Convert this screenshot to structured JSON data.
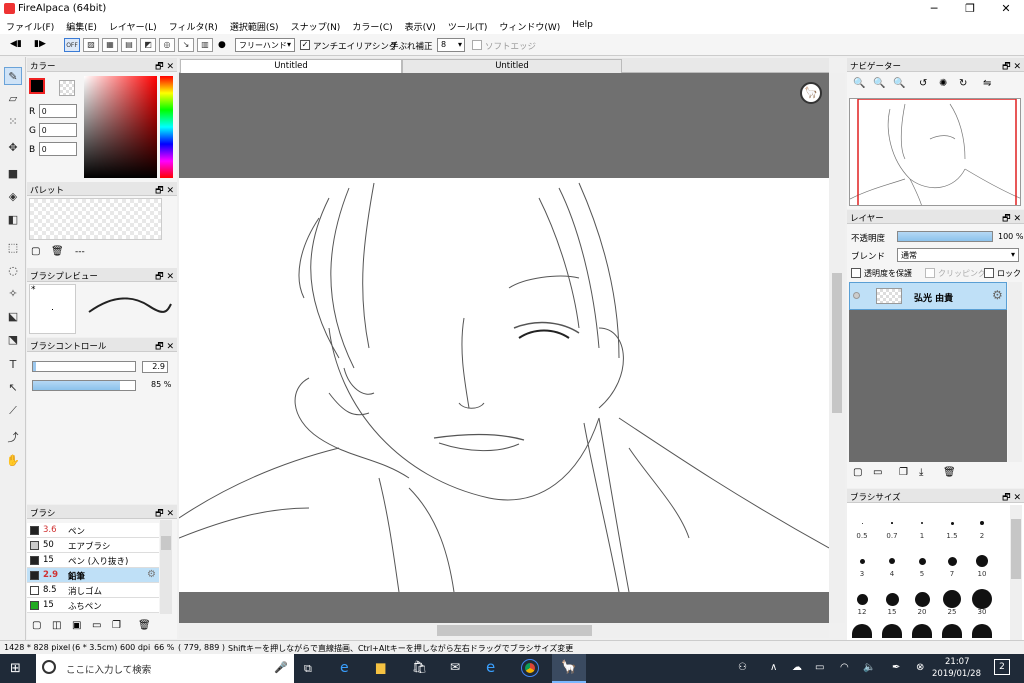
{
  "window": {
    "title": "FireAlpaca (64bit)"
  },
  "menu": [
    "ファイル(F)",
    "編集(E)",
    "レイヤー(L)",
    "フィルタ(R)",
    "選択範囲(S)",
    "スナップ(N)",
    "カラー(C)",
    "表示(V)",
    "ツール(T)",
    "ウィンドウ(W)",
    "Help"
  ],
  "toolbar": {
    "stroke_mode": "フリーハンド",
    "antialias_label": "アンチエイリアシング",
    "stabilizer_label": "手ぶれ補正",
    "stabilizer_value": "8",
    "soft_edge_label": "ソフトエッジ",
    "snap_off_label": "OFF"
  },
  "tabs": [
    "Untitled",
    "Untitled"
  ],
  "color_panel": {
    "title": "カラー",
    "r_label": "R",
    "g_label": "G",
    "b_label": "B",
    "r": "0",
    "g": "0",
    "b": "0"
  },
  "palette_panel": {
    "title": "パレット",
    "dashes": "---"
  },
  "brush_preview_panel": {
    "title": "ブラシプレビュー",
    "star": "*"
  },
  "brush_control_panel": {
    "title": "ブラシコントロール",
    "size": "2.9",
    "opacity": "85 %",
    "size_fill": 0.03,
    "opacity_fill": 0.85
  },
  "brush_panel": {
    "title": "ブラシ",
    "items": [
      {
        "size": "3.6",
        "name": "ペン",
        "color": "#222222",
        "size_color": "#d03030"
      },
      {
        "size": "50",
        "name": "エアブラシ",
        "color": "#cccccc",
        "size_color": "#000000"
      },
      {
        "size": "15",
        "name": "ペン (入り抜き)",
        "color": "#222222",
        "size_color": "#000000"
      },
      {
        "size": "2.9",
        "name": "鉛筆",
        "color": "#222222",
        "size_color": "#d03030",
        "selected": true
      },
      {
        "size": "8.5",
        "name": "消しゴム",
        "color": "#ffffff",
        "size_color": "#000000"
      },
      {
        "size": "15",
        "name": "ふちペン",
        "color": "#22aa22",
        "size_color": "#000000"
      }
    ]
  },
  "navigator_panel": {
    "title": "ナビゲーター"
  },
  "layer_panel": {
    "title": "レイヤー",
    "opacity_label": "不透明度",
    "opacity_value": "100 %",
    "blend_label": "ブレンド",
    "blend_value": "通常",
    "protect_alpha_label": "透明度を保護",
    "clipping_label": "クリッピング",
    "lock_label": "ロック",
    "layer_name": "弘光 由貴"
  },
  "brush_size_panel": {
    "title": "ブラシサイズ",
    "sizes": [
      "0.5",
      "0.7",
      "1",
      "1.5",
      "2",
      "3",
      "4",
      "5",
      "7",
      "10",
      "12",
      "15",
      "20",
      "25",
      "30"
    ]
  },
  "status": {
    "dimensions": "1428 * 828 pixel",
    "physical": "(6 * 3.5cm)",
    "dpi": "600 dpi",
    "zoom": "66 %",
    "cursor": "( 779, 889 )",
    "hint": "Shiftキーを押しながらで直線描画、Ctrl+Altキーを押しながら左右ドラッグでブラシサイズ変更"
  },
  "taskbar": {
    "search_placeholder": "ここに入力して検索",
    "time": "21:07",
    "date": "2019/01/28",
    "notifications": "2"
  }
}
